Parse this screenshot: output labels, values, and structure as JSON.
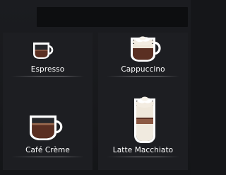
{
  "title_bar": {
    "text": ""
  },
  "products": [
    {
      "name": "Espresso",
      "icon": "espresso-cup-icon"
    },
    {
      "name": "Cappuccino",
      "icon": "cappuccino-cup-icon"
    },
    {
      "name": "Café Crème",
      "icon": "cafe-creme-cup-icon"
    },
    {
      "name": "Latte Macchiato",
      "icon": "latte-macchiato-glass-icon"
    }
  ],
  "colors": {
    "background": "#18191c",
    "title_bar": "#0d0e10",
    "coffee": "#5a2f22",
    "foam": "#e8e1d4",
    "text": "#ffffff"
  }
}
